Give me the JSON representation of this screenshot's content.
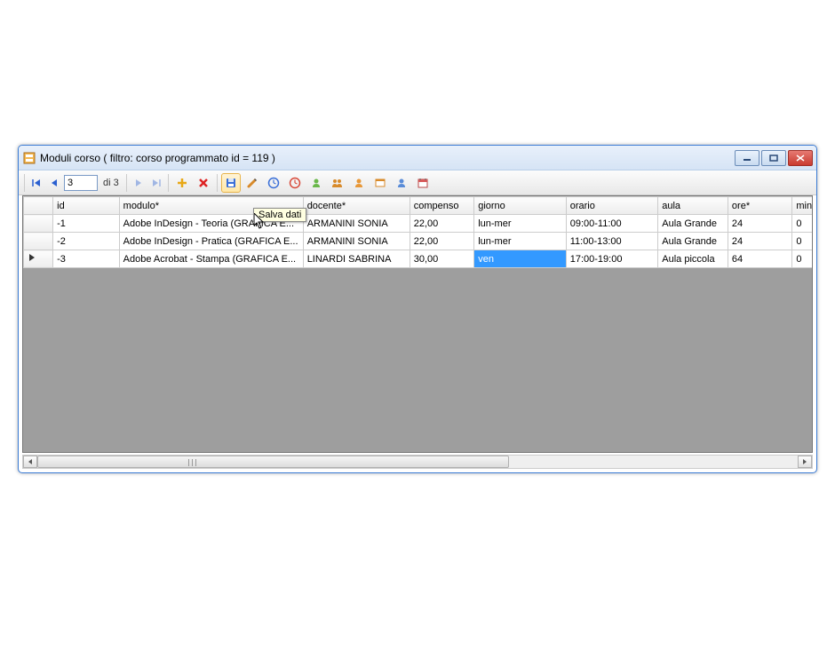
{
  "window": {
    "title": "Moduli corso ( filtro: corso programmato id = 119 )"
  },
  "navigator": {
    "position": "3",
    "total_prefix": "di ",
    "total": "3"
  },
  "tooltip": "Salva dati",
  "columns": {
    "id": "id",
    "modulo": "modulo*",
    "docente": "docente*",
    "compenso": "compenso",
    "giorno": "giorno",
    "orario": "orario",
    "aula": "aula",
    "ore": "ore*",
    "minuti": "minuti*"
  },
  "rows": [
    {
      "id": "-1",
      "modulo": "Adobe InDesign - Teoria (GRAFICA E...",
      "docente": "ARMANINI SONIA",
      "compenso": "22,00",
      "giorno": "lun-mer",
      "orario": "09:00-11:00",
      "aula": "Aula Grande",
      "ore": "24",
      "minuti": "0",
      "current": false,
      "giorno_sel": false
    },
    {
      "id": "-2",
      "modulo": "Adobe InDesign - Pratica (GRAFICA E...",
      "docente": "ARMANINI SONIA",
      "compenso": "22,00",
      "giorno": "lun-mer",
      "orario": "11:00-13:00",
      "aula": "Aula Grande",
      "ore": "24",
      "minuti": "0",
      "current": false,
      "giorno_sel": false
    },
    {
      "id": "-3",
      "modulo": "Adobe Acrobat - Stampa (GRAFICA E...",
      "docente": "LINARDI SABRINA",
      "compenso": "30,00",
      "giorno": "ven",
      "orario": "17:00-19:00",
      "aula": "Aula piccola",
      "ore": "64",
      "minuti": "0",
      "current": true,
      "giorno_sel": true
    }
  ]
}
